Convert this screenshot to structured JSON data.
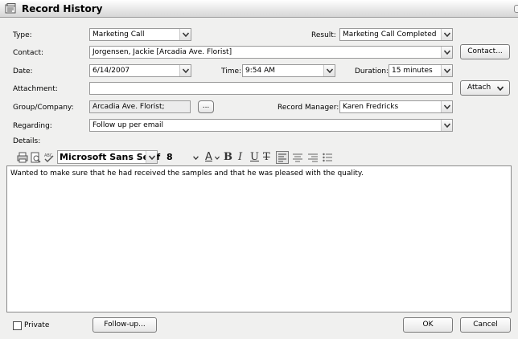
{
  "window": {
    "title": "Record History"
  },
  "form": {
    "type_label": "Type:",
    "type_value": "Marketing Call",
    "result_label": "Result:",
    "result_value": "Marketing Call Completed",
    "contact_label": "Contact:",
    "contact_value": "Jorgensen, Jackie [Arcadia Ave. Florist]",
    "contact_button": "Contact...",
    "date_label": "Date:",
    "date_value": "6/14/2007",
    "time_label": "Time:",
    "time_value": "9:54 AM",
    "duration_label": "Duration:",
    "duration_value": "15 minutes",
    "attachment_label": "Attachment:",
    "attachment_value": "",
    "attach_button": "Attach",
    "group_label": "Group/Company:",
    "group_value": "Arcadia Ave. Florist;",
    "browse_button": "...",
    "manager_label": "Record Manager:",
    "manager_value": "Karen Fredricks",
    "regarding_label": "Regarding:",
    "regarding_value": "Follow up per email",
    "details_label": "Details:"
  },
  "toolbar": {
    "font_name": "Microsoft Sans Serif",
    "font_size": "8",
    "icons": [
      "print-icon",
      "print-preview-icon",
      "spell-check-icon",
      "font-color-icon",
      "bold-icon",
      "italic-icon",
      "underline-icon",
      "strikethrough-icon",
      "align-left-icon",
      "align-center-icon",
      "align-right-icon",
      "bullets-icon"
    ]
  },
  "details": {
    "text": "Wanted to make sure that he had received the samples and that he was pleased with the quality."
  },
  "footer": {
    "private_label": "Private",
    "private_checked": false,
    "followup_button": "Follow-up...",
    "ok_button": "OK",
    "cancel_button": "Cancel"
  }
}
